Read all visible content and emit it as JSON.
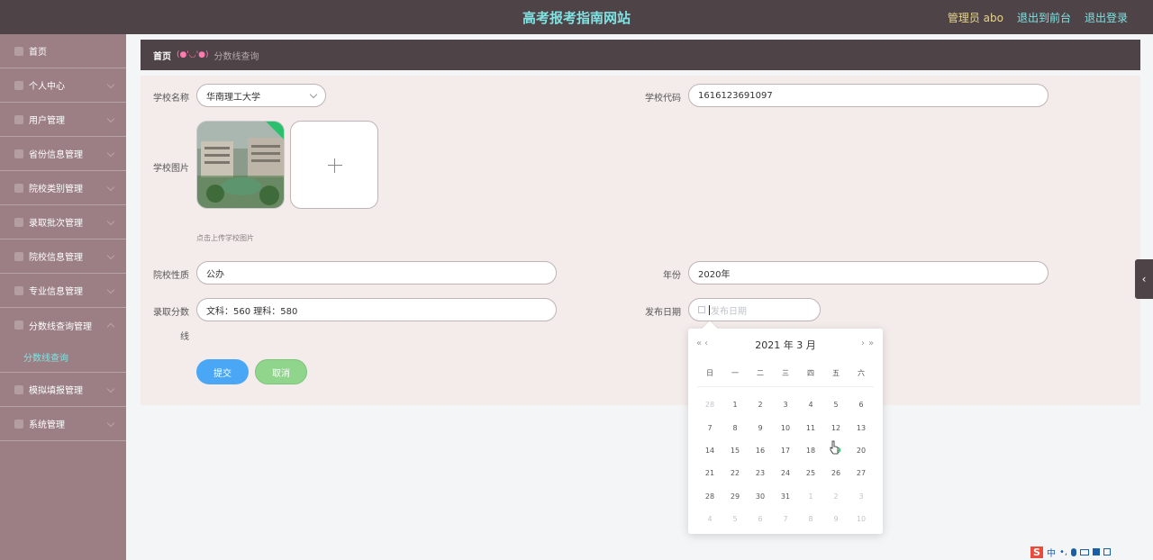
{
  "header": {
    "title": "高考报考指南网站",
    "admin_label": "管理员 abo",
    "link_front": "退出到前台",
    "link_logout": "退出登录"
  },
  "sidebar": {
    "items": [
      {
        "label": "首页",
        "icon": "home-icon"
      },
      {
        "label": "个人中心",
        "icon": "user-icon"
      },
      {
        "label": "用户管理",
        "icon": "users-icon"
      },
      {
        "label": "省份信息管理",
        "icon": "map-icon"
      },
      {
        "label": "院校类别管理",
        "icon": "category-icon"
      },
      {
        "label": "录取批次管理",
        "icon": "batch-icon"
      },
      {
        "label": "院校信息管理",
        "icon": "school-icon"
      },
      {
        "label": "专业信息管理",
        "icon": "major-icon"
      },
      {
        "label": "分数线查询管理",
        "icon": "score-icon"
      },
      {
        "label": "模拟填报管理",
        "icon": "simulate-icon"
      },
      {
        "label": "系统管理",
        "icon": "settings-icon"
      }
    ],
    "active_sub": "分数线查询"
  },
  "breadcrumb": {
    "home": "首页",
    "separator": "(●'◡'●)",
    "current": "分数线查询"
  },
  "form": {
    "school_name_label": "学校名称",
    "school_name_value": "华南理工大学",
    "school_code_label": "学校代码",
    "school_code_value": "1616123691097",
    "school_image_label": "学校图片",
    "upload_hint": "点击上传学校图片",
    "school_type_label": "院校性质",
    "school_type_value": "公办",
    "year_label": "年份",
    "year_value": "2020年",
    "score_label_1": "录取分数",
    "score_label_2": "线",
    "score_value": "文科：560  理科：580",
    "publish_date_label": "发布日期",
    "publish_date_placeholder": "发布日期",
    "submit_label": "提交",
    "cancel_label": "取消"
  },
  "datepicker": {
    "year": "2021 年",
    "month": "3 月",
    "prev_year": "«",
    "prev_month": "‹",
    "next_month": "›",
    "next_year": "»",
    "weekdays": [
      "日",
      "一",
      "二",
      "三",
      "四",
      "五",
      "六"
    ],
    "weeks": [
      [
        "28",
        "1",
        "2",
        "3",
        "4",
        "5",
        "6"
      ],
      [
        "7",
        "8",
        "9",
        "10",
        "11",
        "12",
        "13"
      ],
      [
        "14",
        "15",
        "16",
        "17",
        "18",
        "19",
        "20"
      ],
      [
        "21",
        "22",
        "23",
        "24",
        "25",
        "26",
        "27"
      ],
      [
        "28",
        "29",
        "30",
        "31",
        "1",
        "2",
        "3"
      ],
      [
        "4",
        "5",
        "6",
        "7",
        "8",
        "9",
        "10"
      ]
    ],
    "today": "19"
  },
  "ime": {
    "brand": "S",
    "lang": "中",
    "punct": "•,"
  }
}
